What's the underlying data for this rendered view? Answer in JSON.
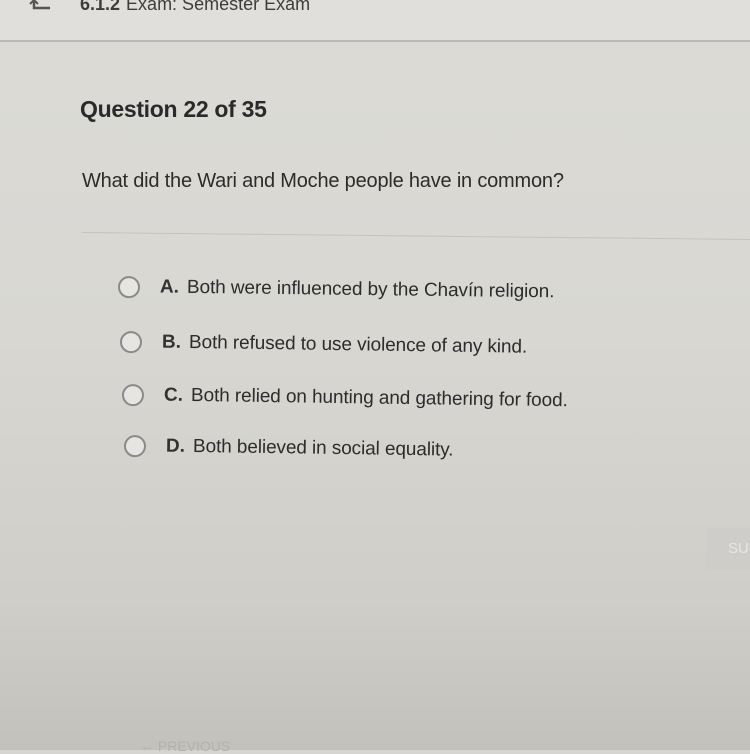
{
  "header": {
    "exam_code": "6.1.2",
    "exam_title": "Exam: Semester Exam",
    "back_icon": "back-arrow-icon"
  },
  "question": {
    "number_label": "Question 22 of 35",
    "text": "What did the Wari and Moche people have in common?"
  },
  "answers": [
    {
      "letter": "A.",
      "text": "Both were influenced by the Chavín religion."
    },
    {
      "letter": "B.",
      "text": "Both refused to use violence of any kind."
    },
    {
      "letter": "C.",
      "text": "Both relied on hunting and gathering for food."
    },
    {
      "letter": "D.",
      "text": "Both believed in social equality."
    }
  ],
  "footer": {
    "submit_label": "SUBMIT",
    "previous_label": "← PREVIOUS"
  }
}
